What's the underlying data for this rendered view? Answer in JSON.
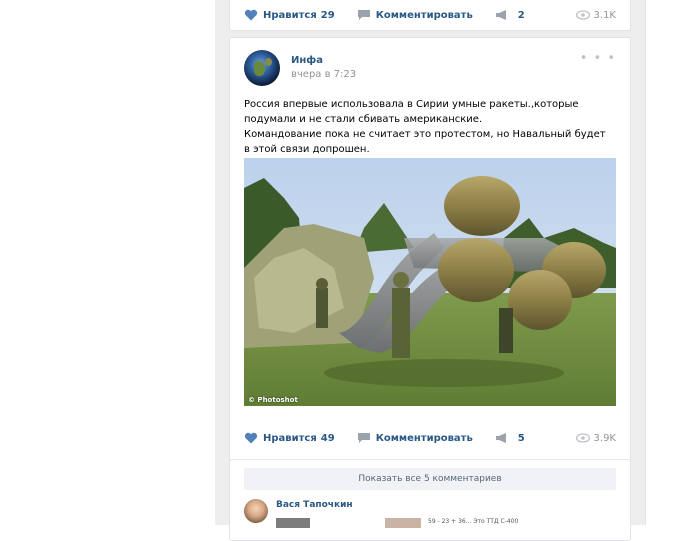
{
  "top_post": {
    "like_label": "Нравится",
    "like_count": "29",
    "comment_label": "Комментировать",
    "share_count": "2",
    "views": "3.1K"
  },
  "post": {
    "author": "Инфа",
    "time": "вчера в 7:23",
    "text_line1": "Россия впервые использовала в Сирии умные ракеты.,которые подумали и не стали сбивать американские.",
    "text_line2": "Командование пока не считает это протестом, но Навальный будет в этой связи допрошен.",
    "photo_watermark": "© Photoshot",
    "like_label": "Нравится",
    "like_count": "49",
    "comment_label": "Комментировать",
    "share_count": "5",
    "views": "3.9K"
  },
  "comments": {
    "show_all_label": "Показать все 5 комментариев",
    "first_author": "Вася Тапочкин",
    "first_snippet": "59 - 23 + 36... Это ТТД С-400"
  },
  "icons": {
    "like": "heart-icon",
    "comment": "comment-bubble-icon",
    "share": "megaphone-icon",
    "views": "eye-icon",
    "more": "more-dots-icon"
  },
  "colors": {
    "link": "#2a5885",
    "muted": "#939393",
    "icon": "#99a2ad"
  }
}
